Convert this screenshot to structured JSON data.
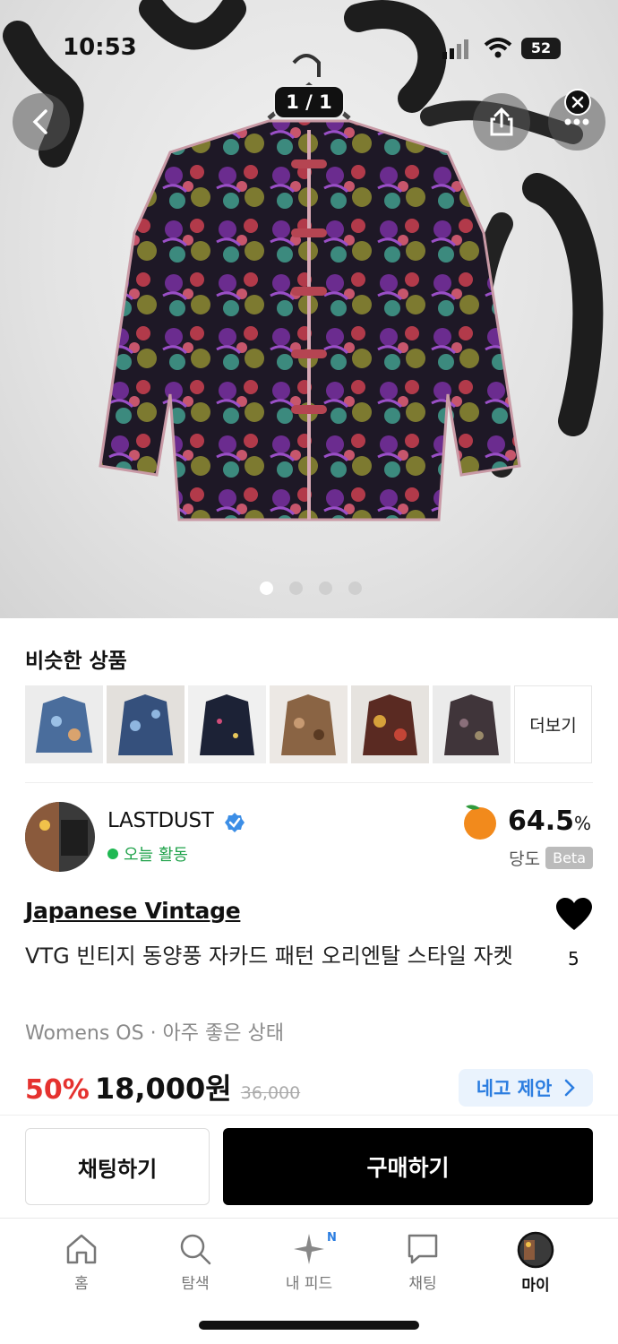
{
  "status_bar": {
    "time": "10:53",
    "battery": "52"
  },
  "gallery": {
    "counter": "1 / 1",
    "page_count": 4,
    "active_page": 1
  },
  "similar": {
    "title": "비슷한 상품",
    "more_label": "더보기",
    "items": [
      {
        "name": "similar-item-1",
        "color": "#4a6d9c"
      },
      {
        "name": "similar-item-2",
        "color": "#35507c"
      },
      {
        "name": "similar-item-3",
        "color": "#1c2236"
      },
      {
        "name": "similar-item-4",
        "color": "#8a6444"
      },
      {
        "name": "similar-item-5",
        "color": "#5a2a22"
      },
      {
        "name": "similar-item-6",
        "color": "#40353a"
      }
    ]
  },
  "seller": {
    "name": "LASTDUST",
    "activity": "오늘 활동",
    "score": "64.5",
    "score_unit": "%",
    "score_label": "당도",
    "beta": "Beta"
  },
  "product": {
    "brand": "Japanese Vintage",
    "title": "VTG 빈티지 동양풍 자카드 패턴 오리엔탈 스타일 자켓",
    "likes": "5",
    "meta": "Womens OS · 아주 좋은 상태",
    "discount": "50%",
    "price": "18,000원",
    "original_price": "36,000",
    "offer_label": "네고 제안"
  },
  "actions": {
    "chat": "채팅하기",
    "buy": "구매하기"
  },
  "tabs": [
    {
      "label": "홈",
      "icon": "home-icon"
    },
    {
      "label": "탐색",
      "icon": "search-icon"
    },
    {
      "label": "내 피드",
      "icon": "sparkle-icon",
      "badge": "N"
    },
    {
      "label": "채팅",
      "icon": "chat-bubble-icon"
    },
    {
      "label": "마이",
      "icon": "avatar-icon",
      "active": true
    }
  ],
  "colors": {
    "accent_red": "#e5322f",
    "accent_blue": "#2b7de0",
    "active_green": "#1fb852"
  }
}
